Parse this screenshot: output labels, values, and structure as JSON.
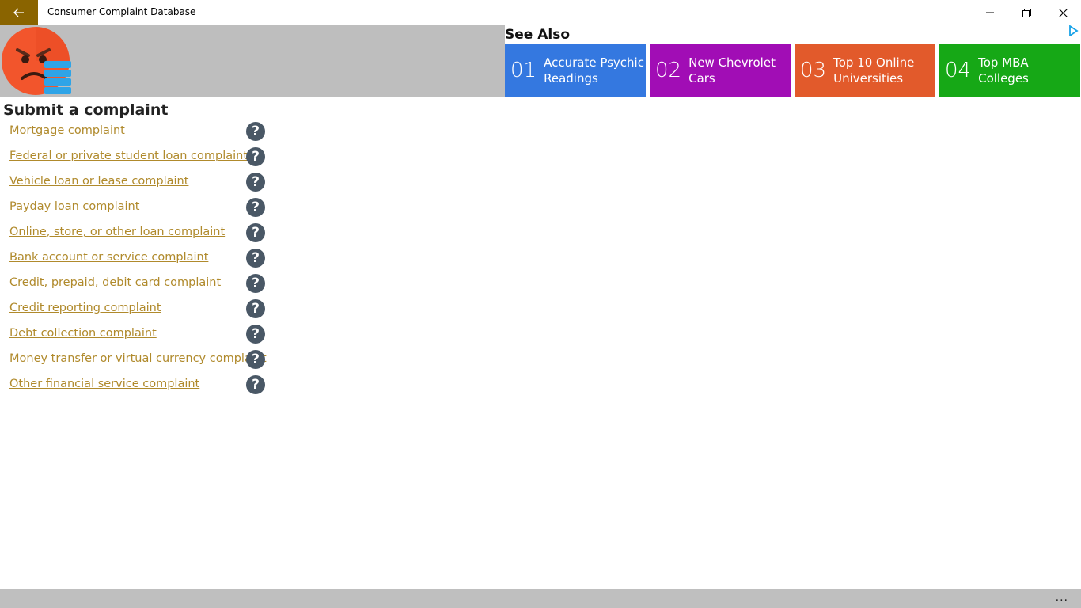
{
  "window": {
    "title": "Consumer Complaint Database"
  },
  "see_also": {
    "title": "See Also",
    "tiles": [
      {
        "num": "01",
        "label": "Accurate Psychic Readings",
        "color": "#3478e0"
      },
      {
        "num": "02",
        "label": "New Chevrolet Cars",
        "color": "#a10db5"
      },
      {
        "num": "03",
        "label": "Top 10 Online Universities",
        "color": "#e25a2b"
      },
      {
        "num": "04",
        "label": "Top MBA Colleges",
        "color": "#16a816"
      }
    ]
  },
  "main": {
    "title": "Submit a complaint",
    "complaints": [
      "Mortgage complaint",
      "Federal or private student loan complaint",
      "Vehicle loan or lease complaint",
      "Payday loan complaint",
      "Online, store, or other loan complaint",
      "Bank account or service complaint",
      "Credit, prepaid, debit card complaint",
      "Credit reporting complaint",
      "Debt collection complaint",
      "Money transfer or virtual currency complaint",
      "Other financial service complaint"
    ],
    "help_glyph": "?"
  },
  "bottombar": {
    "more": "..."
  }
}
